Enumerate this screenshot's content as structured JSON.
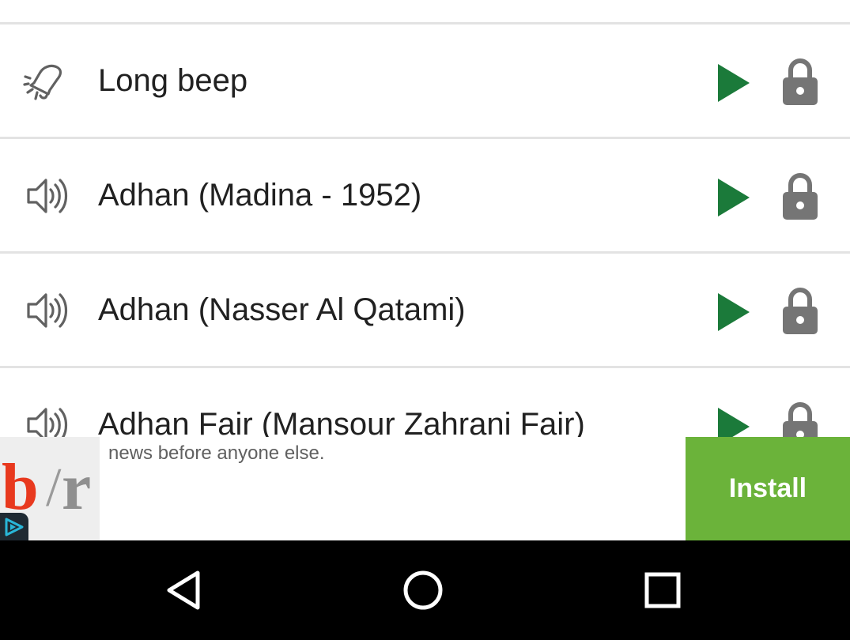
{
  "list": {
    "items": [
      {
        "label": "Long beep",
        "icon": "bell-ringing-icon"
      },
      {
        "label": "Adhan (Madina - 1952)",
        "icon": "speaker-icon"
      },
      {
        "label": "Adhan (Nasser Al Qatami)",
        "icon": "speaker-icon"
      },
      {
        "label": "Adhan Fair (Mansour Zahrani Fair)",
        "icon": "speaker-icon"
      }
    ],
    "play_icon": "play-icon",
    "lock_icon": "lock-icon",
    "play_color": "#1b7a3a",
    "lock_color": "#757575"
  },
  "ad": {
    "logo_b": "b",
    "logo_slash": "/",
    "logo_r": "r",
    "text": "news before anyone else.",
    "install_label": "Install",
    "install_color": "#6bb33a",
    "choices_icon": "adchoices-icon"
  },
  "navbar": {
    "back_icon": "back-icon",
    "home_icon": "home-icon",
    "recents_icon": "recents-icon"
  }
}
